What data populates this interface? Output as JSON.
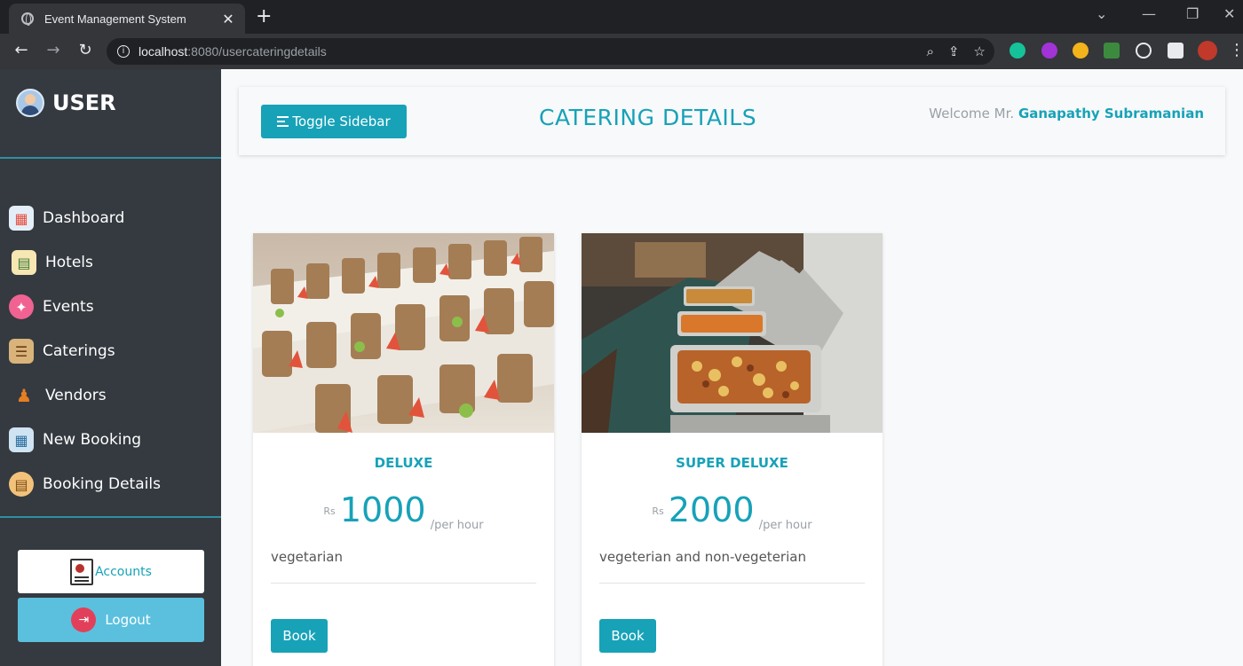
{
  "browser": {
    "tab_title": "Event Management System",
    "url_host": "localhost",
    "url_rest": ":8080/usercateringdetails"
  },
  "sidebar": {
    "brand": "USER",
    "items": [
      {
        "label": "Dashboard",
        "icon": "dashboard-icon"
      },
      {
        "label": "Hotels",
        "icon": "hotel-calendar-icon"
      },
      {
        "label": "Events",
        "icon": "events-icon"
      },
      {
        "label": "Caterings",
        "icon": "catering-icon"
      },
      {
        "label": "Vendors",
        "icon": "vendor-icon"
      },
      {
        "label": "New Booking",
        "icon": "new-booking-icon"
      },
      {
        "label": "Booking Details",
        "icon": "booking-details-icon"
      }
    ],
    "accounts_label": "Accounts",
    "logout_label": "Logout"
  },
  "header": {
    "toggle_label": "Toggle Sidebar",
    "title": "CATERING DETAILS",
    "welcome_prefix": "Welcome Mr.",
    "user_name": "Ganapathy Subramanian"
  },
  "cards": [
    {
      "title": "DELUXE",
      "currency": "Rs",
      "price": "1000",
      "unit": "/per hour",
      "description": "vegetarian",
      "button": "Book"
    },
    {
      "title": "SUPER DELUXE",
      "currency": "Rs",
      "price": "2000",
      "unit": "/per hour",
      "description": "vegeterian and non-vegeterian",
      "button": "Book"
    }
  ],
  "colors": {
    "accent": "#17a2b8",
    "sidebar_bg": "#343a40",
    "logout_bg": "#5bc0de"
  }
}
